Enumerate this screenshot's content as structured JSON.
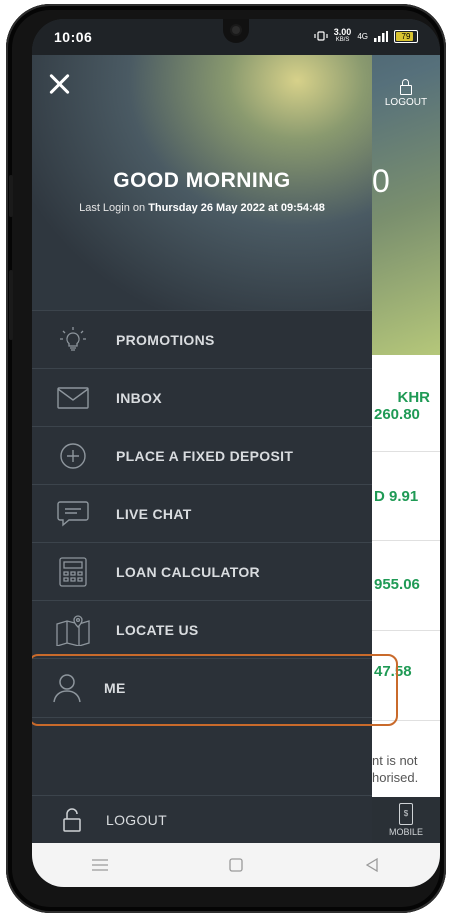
{
  "status_bar": {
    "time": "10:06",
    "speed": "3.00",
    "speed_unit": "KB/S",
    "network": "4G",
    "battery": "79"
  },
  "background_app": {
    "logout_label": "LOGOUT",
    "balance_fragment": "0",
    "accounts": [
      {
        "line1": "KHR",
        "line2": "260.80"
      },
      {
        "line1": "D 9.91",
        "line2": ""
      },
      {
        "line1": "955.06",
        "line2": ""
      },
      {
        "line1": "47.58",
        "line2": ""
      }
    ],
    "note_line1": "nt is not",
    "note_line2": "horised.",
    "mobile_tab_label": "MOBILE"
  },
  "drawer": {
    "greeting": "GOOD MORNING",
    "last_login_prefix": "Last Login on ",
    "last_login_value": "Thursday 26 May 2022 at 09:54:48",
    "menu": [
      {
        "label": "PROMOTIONS",
        "icon": "lightbulb-icon"
      },
      {
        "label": "INBOX",
        "icon": "envelope-icon"
      },
      {
        "label": "PLACE A FIXED DEPOSIT",
        "icon": "plus-circle-icon"
      },
      {
        "label": "LIVE CHAT",
        "icon": "chat-bubble-icon"
      },
      {
        "label": "LOAN CALCULATOR",
        "icon": "calculator-icon"
      },
      {
        "label": "LOCATE US",
        "icon": "map-pin-icon"
      },
      {
        "label": "ME",
        "icon": "user-icon"
      }
    ],
    "logout_label": "LOGOUT"
  },
  "colors": {
    "highlight": "#c96a2b",
    "positive": "#1f9a55",
    "drawer_bg": "#2b3138"
  }
}
